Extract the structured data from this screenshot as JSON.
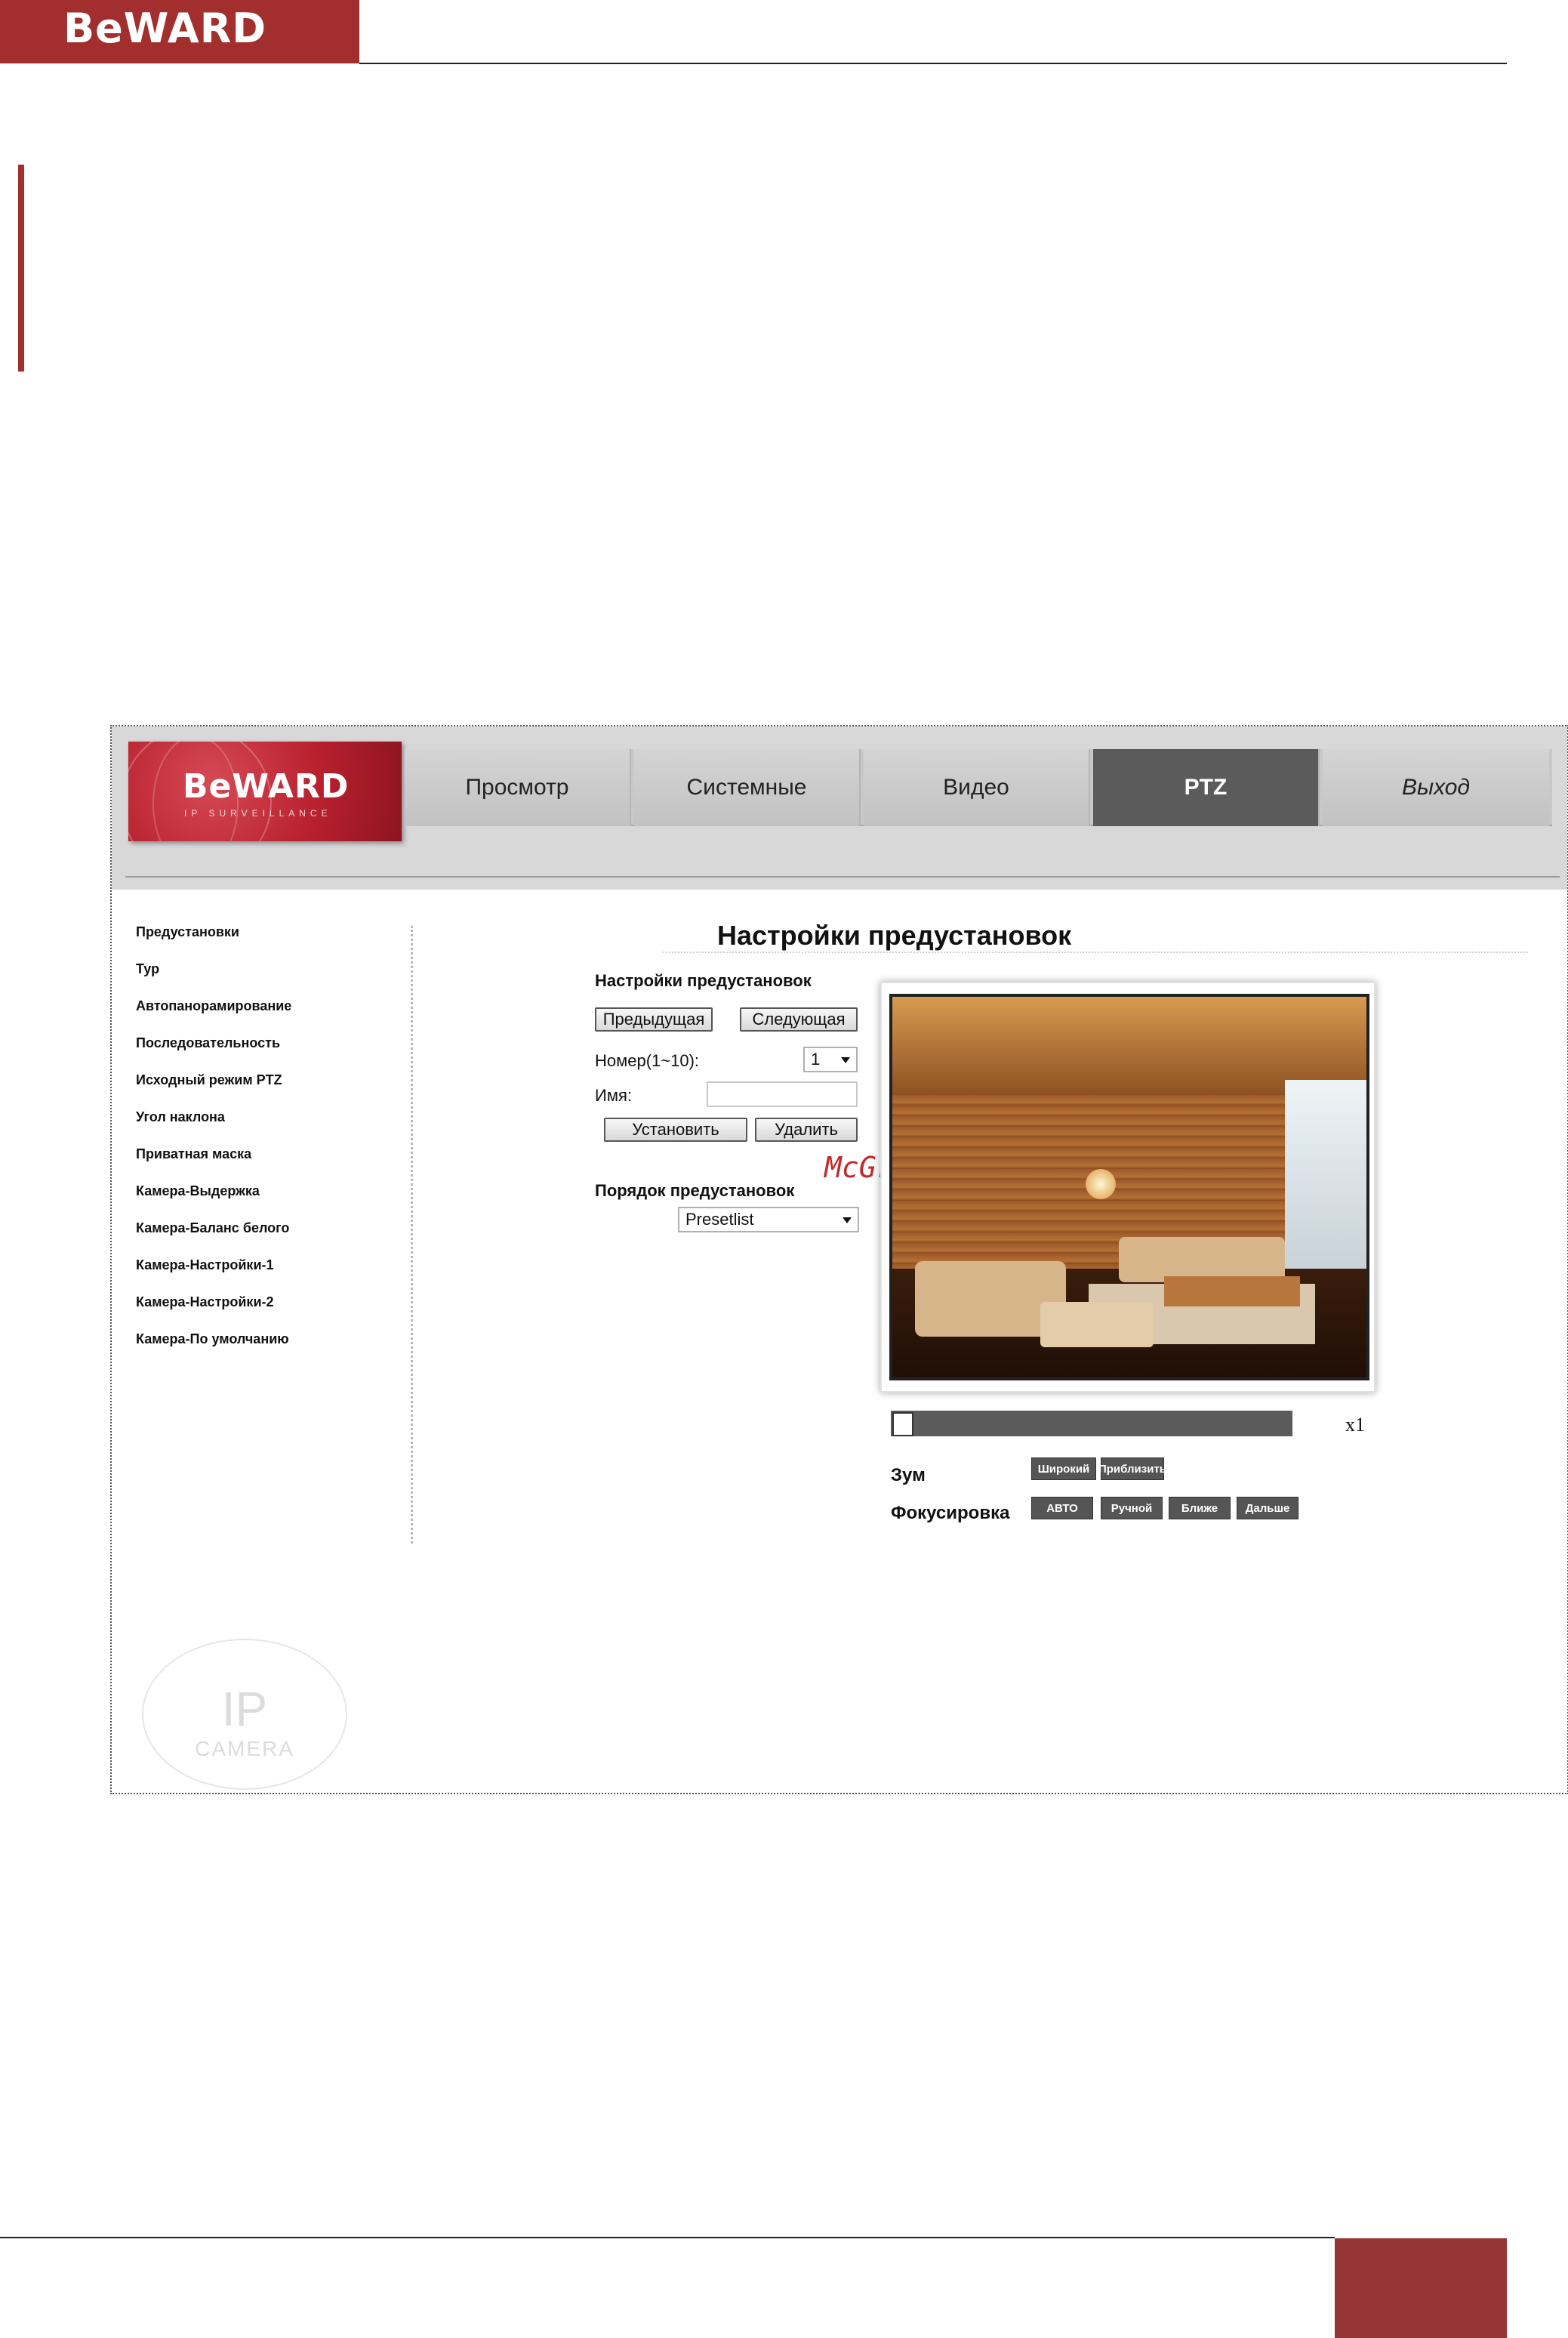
{
  "document": {
    "header_logo": "BeWARD"
  },
  "brand": {
    "name": "BeWARD",
    "subtitle": "IP SURVEILLANCE"
  },
  "nav": {
    "tabs": [
      {
        "label": "Просмотр",
        "active": false
      },
      {
        "label": "Системные",
        "active": false
      },
      {
        "label": "Видео",
        "active": false
      },
      {
        "label": "PTZ",
        "active": true
      },
      {
        "label": "Выход",
        "active": false
      }
    ]
  },
  "sidebar": {
    "items": [
      "Предустановки",
      "Тур",
      "Автопанорамирование",
      "Последовательность",
      "Исходный режим PTZ",
      "Угол наклона",
      "Приватная маска",
      "Камера-Выдержка",
      "Камера-Баланс белого",
      "Камера-Настройки-1",
      "Камера-Настройки-2",
      "Камера-По умолчанию"
    ]
  },
  "watermark": {
    "big": "IP",
    "small": "CAMERA"
  },
  "main": {
    "title": "Настройки предустановок",
    "preset_section_label": "Настройки предустановок",
    "prev_button": "Предыдущая",
    "next_button": "Следующая",
    "number_label": "Номер(1~10):",
    "number_value": "1",
    "name_label": "Имя:",
    "name_value": "",
    "set_button": "Установить",
    "delete_button": "Удалить",
    "order_label": "Порядок предустановок",
    "order_value": "Presetlist",
    "overlay_watermark": "McGrp.Ru"
  },
  "view": {
    "zoom_level_text": "x1",
    "zoom_level": 0,
    "zoom_label": "Зум",
    "zoom_wide": "Широкий",
    "zoom_tele": "Приблизить",
    "focus_label": "Фокусировка",
    "focus_auto": "АВТО",
    "focus_manual": "Ручной",
    "focus_near": "Ближе",
    "focus_far": "Дальше"
  },
  "colors": {
    "brand_red": "#a32e2e",
    "active_tab": "#5b5b5b",
    "dark_button": "#555555"
  }
}
